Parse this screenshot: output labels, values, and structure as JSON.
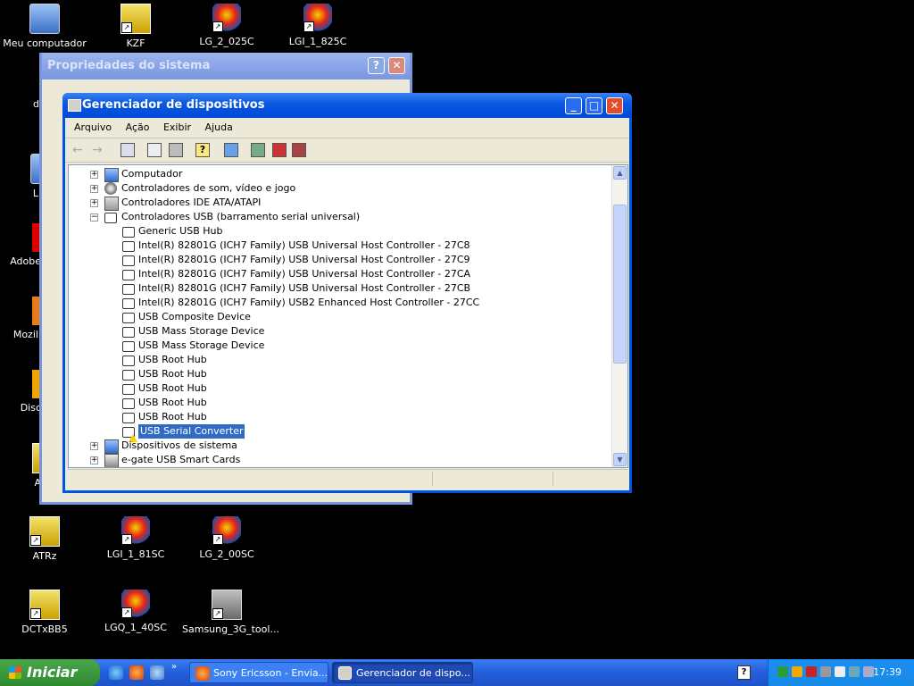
{
  "desktop": {
    "icons": [
      {
        "label": "Meu computador",
        "icon": "my-computer-icon"
      },
      {
        "label": "KZF",
        "icon": "app-shortcut-icon"
      },
      {
        "label": "LG_2_025C",
        "icon": "lg-shortcut-icon"
      },
      {
        "label": "LGI_1_825C",
        "icon": "lg-shortcut-icon"
      },
      {
        "label": "ATRz",
        "icon": "app-shortcut-icon"
      },
      {
        "label": "LGI_1_81SC",
        "icon": "lg-shortcut-icon"
      },
      {
        "label": "LG_2_00SC",
        "icon": "lg-shortcut-icon"
      },
      {
        "label": "DCTxBB5",
        "icon": "app-shortcut-icon"
      },
      {
        "label": "LGQ_1_40SC",
        "icon": "lg-shortcut-icon"
      },
      {
        "label": "Samsung_3G_tool...",
        "icon": "samsung-tool-icon"
      }
    ],
    "partial_labels": [
      "d",
      "Li",
      "Adobe",
      "Mozill",
      "Disc",
      "A"
    ]
  },
  "bg_window": {
    "title": "Propriedades do sistema"
  },
  "window": {
    "title": "Gerenciador de dispositivos",
    "menu": [
      "Arquivo",
      "Ação",
      "Exibir",
      "Ajuda"
    ],
    "toolbar_icons": [
      "back-icon",
      "forward-icon",
      "show-hide-console-tree-icon",
      "properties-icon",
      "print-icon",
      "help-icon",
      "scan-hardware-icon",
      "update-driver-icon",
      "uninstall-icon",
      "disable-icon"
    ],
    "tree": [
      {
        "label": "Computador",
        "level": 0,
        "expander": "+",
        "icon": "computer-icon"
      },
      {
        "label": "Controladores de som, vídeo e jogo",
        "level": 0,
        "expander": "+",
        "icon": "sound-icon"
      },
      {
        "label": "Controladores IDE ATA/ATAPI",
        "level": 0,
        "expander": "+",
        "icon": "ide-icon"
      },
      {
        "label": "Controladores USB (barramento serial universal)",
        "level": 0,
        "expander": "−",
        "icon": "usb-icon"
      },
      {
        "label": "Generic USB Hub",
        "level": 1,
        "icon": "usb-icon"
      },
      {
        "label": "Intel(R) 82801G (ICH7 Family) USB Universal Host Controller - 27C8",
        "level": 1,
        "icon": "usb-icon"
      },
      {
        "label": "Intel(R) 82801G (ICH7 Family) USB Universal Host Controller - 27C9",
        "level": 1,
        "icon": "usb-icon"
      },
      {
        "label": "Intel(R) 82801G (ICH7 Family) USB Universal Host Controller - 27CA",
        "level": 1,
        "icon": "usb-icon"
      },
      {
        "label": "Intel(R) 82801G (ICH7 Family) USB Universal Host Controller - 27CB",
        "level": 1,
        "icon": "usb-icon"
      },
      {
        "label": "Intel(R) 82801G (ICH7 Family) USB2 Enhanced Host Controller - 27CC",
        "level": 1,
        "icon": "usb-icon"
      },
      {
        "label": "USB Composite Device",
        "level": 1,
        "icon": "usb-icon"
      },
      {
        "label": "USB Mass Storage Device",
        "level": 1,
        "icon": "usb-icon"
      },
      {
        "label": "USB Mass Storage Device",
        "level": 1,
        "icon": "usb-icon"
      },
      {
        "label": "USB Root Hub",
        "level": 1,
        "icon": "usb-icon"
      },
      {
        "label": "USB Root Hub",
        "level": 1,
        "icon": "usb-icon"
      },
      {
        "label": "USB Root Hub",
        "level": 1,
        "icon": "usb-icon"
      },
      {
        "label": "USB Root Hub",
        "level": 1,
        "icon": "usb-icon"
      },
      {
        "label": "USB Root Hub",
        "level": 1,
        "icon": "usb-icon"
      },
      {
        "label": "USB Serial Converter",
        "level": 1,
        "icon": "usb-warning-icon",
        "selected": true,
        "warning": true
      },
      {
        "label": "Dispositivos de sistema",
        "level": 0,
        "expander": "+",
        "icon": "system-devices-icon"
      },
      {
        "label": "e-gate USB Smart Cards",
        "level": 0,
        "expander": "+",
        "icon": "smart-card-icon"
      }
    ]
  },
  "taskbar": {
    "start_label": "Iniciar",
    "tasks": [
      {
        "label": "Sony Ericsson - Envia...",
        "icon": "firefox-icon"
      },
      {
        "label": "Gerenciador de dispo...",
        "icon": "device-manager-icon"
      }
    ],
    "help_glyph": "?",
    "clock": "17:39"
  },
  "colors": {
    "titlebar_active": "#0054e3",
    "selection": "#316ac5",
    "taskbar": "#245edb",
    "start_green": "#3c9a3c",
    "warning": "#f7d400"
  }
}
